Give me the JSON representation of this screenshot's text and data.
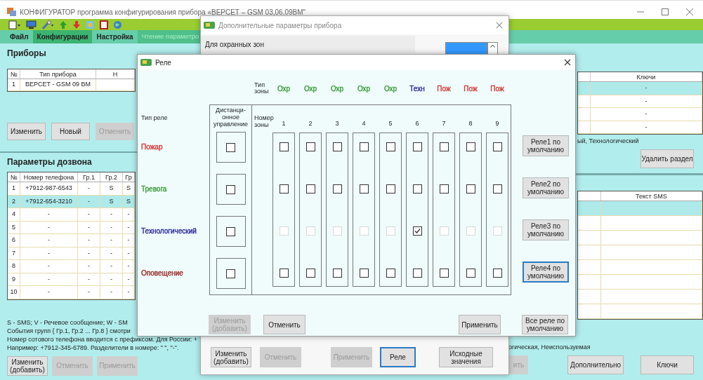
{
  "main_window": {
    "title": "КОНФИГУРАТОР программа конфигурирования прибора «ВЕРСЕТ – GSM 03,06,09ВМ\""
  },
  "menu": [
    {
      "label": "Файл",
      "disabled": false,
      "selected": false
    },
    {
      "label": "Конфигурации",
      "disabled": false,
      "selected": true
    },
    {
      "label": "Настройка",
      "disabled": false,
      "selected": false
    },
    {
      "label": "Чтение параметро",
      "disabled": true,
      "selected": false
    }
  ],
  "devices_panel": {
    "title": "Приборы",
    "columns": [
      "№",
      "Тип прибора",
      "Н"
    ],
    "rows": [
      {
        "cells": [
          "1",
          "ВЕРСЕТ - GSM 09 ВМ"
        ],
        "selected": false
      }
    ],
    "buttons": [
      {
        "label": "Изменить",
        "disabled": false
      },
      {
        "label": "Новый",
        "disabled": false
      },
      {
        "label": "Отменить",
        "disabled": true
      }
    ]
  },
  "dial_panel": {
    "title": "Параметры дозвона",
    "columns": [
      "№",
      "Номер телефона",
      "Гр.1",
      "Гр.2",
      "Гр"
    ],
    "rows": [
      {
        "cells": [
          "1",
          "+7912-987-6543",
          "-",
          "S",
          "S"
        ],
        "selected": false
      },
      {
        "cells": [
          "2",
          "+7912-654-3210",
          "-",
          "S",
          "S"
        ],
        "selected": true
      },
      {
        "cells": [
          "4",
          "-",
          "-",
          "-",
          "-"
        ],
        "selected": false
      },
      {
        "cells": [
          "5",
          "-",
          "-",
          "-",
          "-"
        ],
        "selected": false
      },
      {
        "cells": [
          "6",
          "-",
          "-",
          "-",
          "-"
        ],
        "selected": false
      },
      {
        "cells": [
          "7",
          "-",
          "-",
          "-",
          "-"
        ],
        "selected": false
      },
      {
        "cells": [
          "8",
          "-",
          "-",
          "-",
          "-"
        ],
        "selected": false
      },
      {
        "cells": [
          "9",
          "-",
          "-",
          "-",
          "-"
        ],
        "selected": false
      },
      {
        "cells": [
          "10",
          "-",
          "-",
          "-",
          "-"
        ],
        "selected": false
      }
    ],
    "notes": [
      "S - SMS;  V - Речевое сообщение;  W - SM",
      "События групп { Гр.1, Гр.2 ... Гр.8 } смотри",
      "Номер сотового телефона вводится с префиксом. Для России: +",
      "Например: +7912-345-6789. Разделители в номере: \" \", \"-\"."
    ],
    "buttons": [
      {
        "label": "Изменить (добавить)",
        "disabled": false
      },
      {
        "label": "Отменить",
        "disabled": true
      },
      {
        "label": "Применить",
        "disabled": true
      }
    ]
  },
  "keys_panel": {
    "columns": [
      "Ключи"
    ],
    "rows": [
      {
        "cells": [
          "-"
        ],
        "selected": true
      },
      {
        "cells": [
          "-"
        ],
        "selected": false
      },
      {
        "cells": [
          "-"
        ],
        "selected": false
      },
      {
        "cells": [
          "-"
        ],
        "selected": false
      }
    ],
    "note": "ый, Технологический",
    "delete_button": "Удалить раздел"
  },
  "sms_panel": {
    "columns": [
      "Текст SMS"
    ],
    "rows": [
      {
        "selected": true
      },
      {
        "selected": false
      },
      {
        "selected": false
      },
      {
        "selected": false
      },
      {
        "selected": false
      },
      {
        "selected": false
      },
      {
        "selected": false
      },
      {
        "selected": false
      }
    ],
    "note": "огическая, Неиспользуемая",
    "buttons": [
      {
        "label": "ить",
        "disabled": true
      },
      {
        "label": "Дополнительно",
        "disabled": false
      },
      {
        "label": "Ключи",
        "disabled": false
      }
    ]
  },
  "extra_dialog": {
    "title": "Дополнительные параметры прибора",
    "section": "Для охранных зон",
    "buttons": [
      {
        "label": "Изменить (добавить)",
        "disabled": false,
        "focused": false
      },
      {
        "label": "Отменить",
        "disabled": true,
        "focused": false
      },
      {
        "label": "Применить",
        "disabled": true,
        "focused": false
      },
      {
        "label": "Реле",
        "disabled": false,
        "focused": true
      },
      {
        "label": "Исходные значения",
        "disabled": false,
        "focused": false
      }
    ]
  },
  "relay_dialog": {
    "title": "Реле",
    "zone_type_label": "Тип зоны",
    "relay_type_label": "Тип реле",
    "remote_label": "Дистанци-онное управление",
    "zone_number_label": "Номер зоны",
    "zones": [
      {
        "number": "1",
        "type": "Охр",
        "color": "#3c9c3c"
      },
      {
        "number": "2",
        "type": "Охр",
        "color": "#3c9c3c"
      },
      {
        "number": "3",
        "type": "Охр",
        "color": "#3c9c3c"
      },
      {
        "number": "4",
        "type": "Охр",
        "color": "#3c9c3c"
      },
      {
        "number": "5",
        "type": "Охр",
        "color": "#3c9c3c"
      },
      {
        "number": "6",
        "type": "Техн",
        "color": "#2a2a9a"
      },
      {
        "number": "7",
        "type": "Пож",
        "color": "#d03838"
      },
      {
        "number": "8",
        "type": "Пож",
        "color": "#d03838"
      },
      {
        "number": "9",
        "type": "Пож",
        "color": "#d03838"
      }
    ],
    "relays": [
      {
        "name": "Пожар",
        "color": "#d03838",
        "remote": false,
        "default_button": "Реле1 по умолчанию",
        "focused": false,
        "cells": [
          {
            "checked": false,
            "disabled": false
          },
          {
            "checked": false,
            "disabled": false
          },
          {
            "checked": false,
            "disabled": false
          },
          {
            "checked": false,
            "disabled": false
          },
          {
            "checked": false,
            "disabled": false
          },
          {
            "checked": false,
            "disabled": false
          },
          {
            "checked": false,
            "disabled": false
          },
          {
            "checked": false,
            "disabled": false
          },
          {
            "checked": false,
            "disabled": false
          }
        ]
      },
      {
        "name": "Тревога",
        "color": "#3c9c3c",
        "remote": false,
        "default_button": "Реле2 по умолчанию",
        "focused": false,
        "cells": [
          {
            "checked": false,
            "disabled": false
          },
          {
            "checked": false,
            "disabled": false
          },
          {
            "checked": false,
            "disabled": false
          },
          {
            "checked": false,
            "disabled": false
          },
          {
            "checked": false,
            "disabled": false
          },
          {
            "checked": false,
            "disabled": false
          },
          {
            "checked": false,
            "disabled": false
          },
          {
            "checked": false,
            "disabled": false
          },
          {
            "checked": false,
            "disabled": false
          }
        ]
      },
      {
        "name": "Технологический",
        "color": "#2a2a9a",
        "remote": false,
        "default_button": "Реле3 по умолчанию",
        "focused": false,
        "cells": [
          {
            "checked": false,
            "disabled": true
          },
          {
            "checked": false,
            "disabled": true
          },
          {
            "checked": false,
            "disabled": true
          },
          {
            "checked": false,
            "disabled": true
          },
          {
            "checked": false,
            "disabled": true
          },
          {
            "checked": true,
            "disabled": false
          },
          {
            "checked": false,
            "disabled": true
          },
          {
            "checked": false,
            "disabled": true
          },
          {
            "checked": false,
            "disabled": true
          }
        ]
      },
      {
        "name": "Оповещение",
        "color": "#9a2a2a",
        "remote": false,
        "default_button": "Реле4 по умолчанию",
        "focused": true,
        "cells": [
          {
            "checked": false,
            "disabled": false
          },
          {
            "checked": false,
            "disabled": false
          },
          {
            "checked": false,
            "disabled": false
          },
          {
            "checked": false,
            "disabled": false
          },
          {
            "checked": false,
            "disabled": false
          },
          {
            "checked": false,
            "disabled": false
          },
          {
            "checked": false,
            "disabled": false
          },
          {
            "checked": false,
            "disabled": false
          },
          {
            "checked": false,
            "disabled": false
          }
        ]
      }
    ],
    "all_default_button": "Все реле по умолчанию",
    "buttons": [
      {
        "label": "Изменить (добавить)",
        "disabled": true
      },
      {
        "label": "Отменить",
        "disabled": false
      },
      {
        "label": "Применить",
        "disabled": false
      }
    ]
  }
}
